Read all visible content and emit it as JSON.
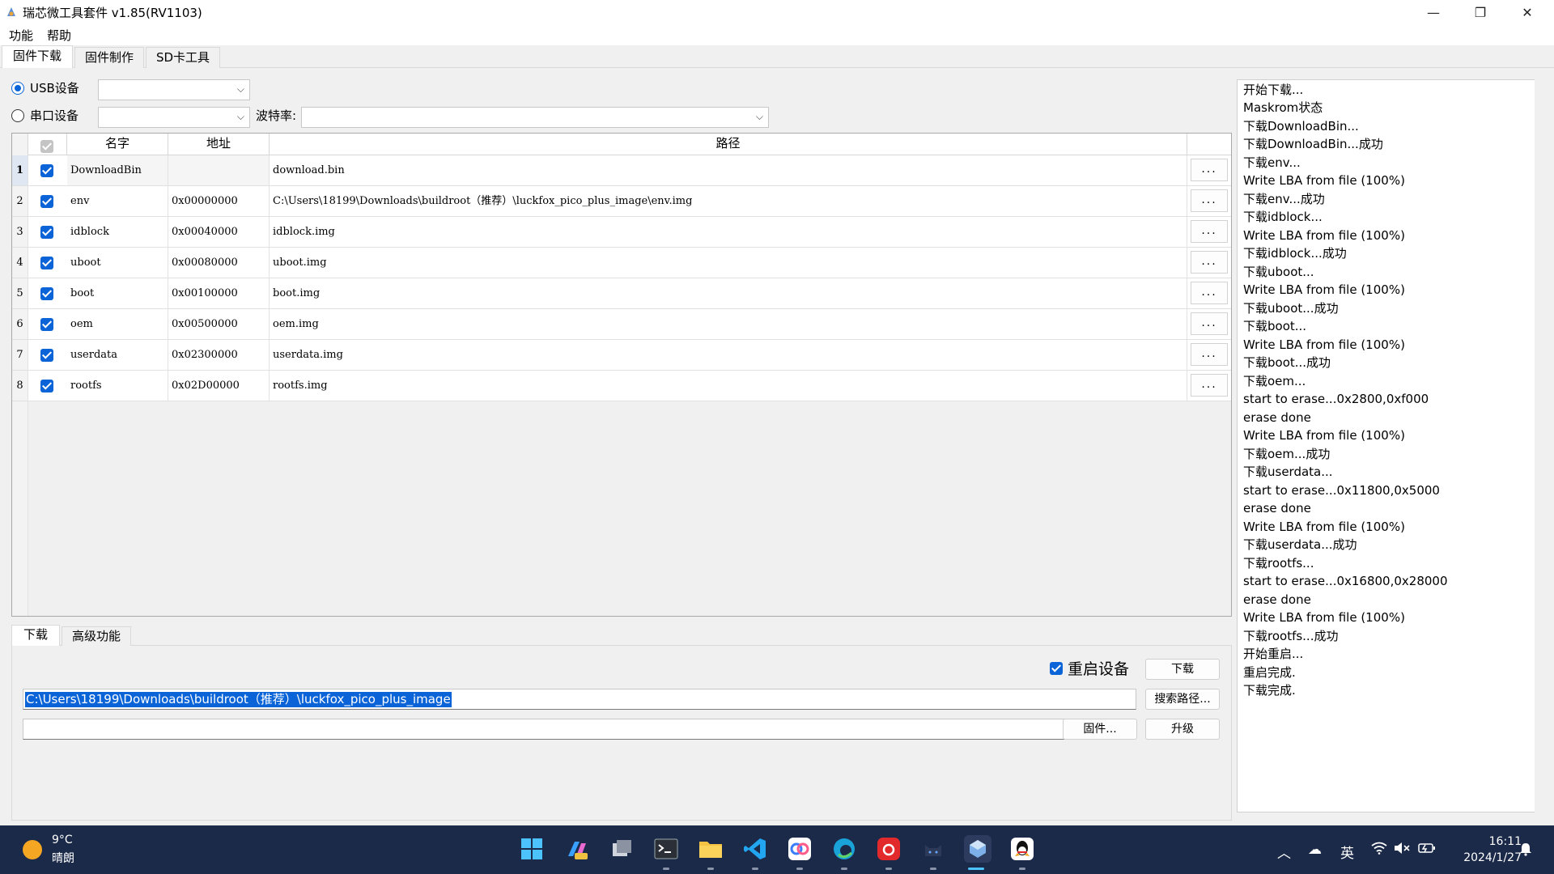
{
  "window": {
    "title": "瑞芯微工具套件 v1.85(RV1103)",
    "minimize": "—",
    "maximize": "❐",
    "close": "✕"
  },
  "menu": [
    "功能",
    "帮助"
  ],
  "top_tabs": [
    "固件下载",
    "固件制作",
    "SD卡工具"
  ],
  "device": {
    "usb_label": "USB设备",
    "serial_label": "串口设备",
    "baud_label": "波特率:",
    "usb_value": "",
    "serial_value": "",
    "baud_value": ""
  },
  "table": {
    "headers": [
      "名字",
      "地址",
      "路径"
    ],
    "rows": [
      {
        "num": "1",
        "name": "DownloadBin",
        "addr": "",
        "path": "download.bin"
      },
      {
        "num": "2",
        "name": "env",
        "addr": "0x00000000",
        "path": "C:\\Users\\18199\\Downloads\\buildroot（推荐）\\luckfox_pico_plus_image\\env.img"
      },
      {
        "num": "3",
        "name": "idblock",
        "addr": "0x00040000",
        "path": "idblock.img"
      },
      {
        "num": "4",
        "name": "uboot",
        "addr": "0x00080000",
        "path": "uboot.img"
      },
      {
        "num": "5",
        "name": "boot",
        "addr": "0x00100000",
        "path": "boot.img"
      },
      {
        "num": "6",
        "name": "oem",
        "addr": "0x00500000",
        "path": "oem.img"
      },
      {
        "num": "7",
        "name": "userdata",
        "addr": "0x02300000",
        "path": "userdata.img"
      },
      {
        "num": "8",
        "name": "rootfs",
        "addr": "0x02D00000",
        "path": "rootfs.img"
      }
    ],
    "browse_label": "..."
  },
  "bottom_tabs": [
    "下载",
    "高级功能"
  ],
  "bottom": {
    "reboot_label": "重启设备",
    "download_btn": "下载",
    "path_value": "C:\\Users\\18199\\Downloads\\buildroot（推荐）\\luckfox_pico_plus_image",
    "search_btn": "搜索路径...",
    "firmware_value": "",
    "firmware_btn": "固件...",
    "upgrade_btn": "升级"
  },
  "log": [
    "开始下载...",
    "Maskrom状态",
    "下载DownloadBin...",
    "下载DownloadBin...成功",
    "下载env...",
    "Write LBA from file (100%)",
    "下载env...成功",
    "下载idblock...",
    "Write LBA from file (100%)",
    "下载idblock...成功",
    "下载uboot...",
    "Write LBA from file (100%)",
    "下载uboot...成功",
    "下载boot...",
    "Write LBA from file (100%)",
    "下载boot...成功",
    "下载oem...",
    "start to erase...0x2800,0xf000",
    "erase done",
    "Write LBA from file (100%)",
    "下载oem...成功",
    "下载userdata...",
    "start to erase...0x11800,0x5000",
    "erase done",
    "Write LBA from file (100%)",
    "下载userdata...成功",
    "下载rootfs...",
    "start to erase...0x16800,0x28000",
    "erase done",
    "Write LBA from file (100%)",
    "下载rootfs...成功",
    "开始重启...",
    "重启完成.",
    "下载完成."
  ],
  "taskbar": {
    "weather_temp": "9°C",
    "weather_desc": "晴朗",
    "ime": "英",
    "time": "16:11",
    "date": "2024/1/27"
  }
}
